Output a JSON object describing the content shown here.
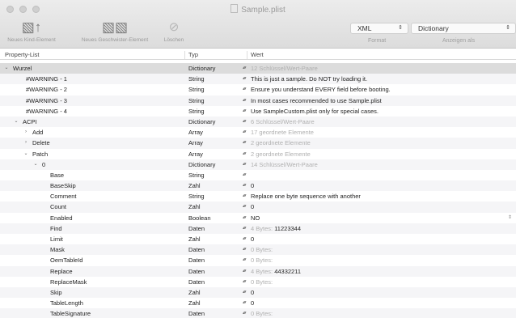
{
  "window": {
    "title": "Sample.plist"
  },
  "toolbar": {
    "add_child_label": "Neues Kind-Element",
    "add_sibling_label": "Neues Geschwister-Element",
    "remove_label": "Löschen"
  },
  "format_select": {
    "value": "XML",
    "label": "Format"
  },
  "type_select": {
    "value": "Dictionary",
    "label": "Anzeigen als"
  },
  "columns": {
    "key": "Property-List",
    "type": "Typ",
    "value": "Wert"
  },
  "rows": [
    {
      "key": "Wurzel",
      "type": "Dictionary",
      "value": "12 Schlüssel/Wert-Paare",
      "disc": "v",
      "gray": true,
      "selected": true
    },
    {
      "key": "#WARNING - 1",
      "type": "String",
      "value": "This is just a sample. Do NOT try loading it."
    },
    {
      "key": "#WARNING - 2",
      "type": "String",
      "value": "Ensure you understand EVERY field before booting."
    },
    {
      "key": "#WARNING - 3",
      "type": "String",
      "value": "In most cases recommended to use Sample.plist"
    },
    {
      "key": "#WARNING - 4",
      "type": "String",
      "value": "Use SampleCustom.plist only for special cases."
    },
    {
      "key": "ACPI",
      "type": "Dictionary",
      "value": "6 Schlüssel/Wert-Paare",
      "disc": "v",
      "gray": true
    },
    {
      "key": "Add",
      "type": "Array",
      "value": "17 geordnete Elemente",
      "disc": ">",
      "gray": true
    },
    {
      "key": "Delete",
      "type": "Array",
      "value": "2 geordnete Elemente",
      "disc": ">",
      "gray": true
    },
    {
      "key": "Patch",
      "type": "Array",
      "value": "2 geordnete Elemente",
      "disc": "v",
      "gray": true
    },
    {
      "key": "0",
      "type": "Dictionary",
      "value": "14 Schlüssel/Wert-Paare",
      "disc": "v",
      "gray": true
    },
    {
      "key": "Base",
      "type": "String",
      "value": ""
    },
    {
      "key": "BaseSkip",
      "type": "Zahl",
      "value": "0"
    },
    {
      "key": "Comment",
      "type": "String",
      "value": "Replace one byte sequence with another"
    },
    {
      "key": "Count",
      "type": "Zahl",
      "value": "0"
    },
    {
      "key": "Enabled",
      "type": "Boolean",
      "value": "NO"
    },
    {
      "key": "Find",
      "type": "Daten",
      "value": "4 Bytes:",
      "value2": "11223344",
      "gray": true
    },
    {
      "key": "Limit",
      "type": "Zahl",
      "value": "0"
    },
    {
      "key": "Mask",
      "type": "Daten",
      "value": "0 Bytes:",
      "gray": true
    },
    {
      "key": "OemTableId",
      "type": "Daten",
      "value": "0 Bytes:",
      "gray": true
    },
    {
      "key": "Replace",
      "type": "Daten",
      "value": "4 Bytes:",
      "value2": "44332211",
      "gray": true
    },
    {
      "key": "ReplaceMask",
      "type": "Daten",
      "value": "0 Bytes:",
      "gray": true
    },
    {
      "key": "Skip",
      "type": "Zahl",
      "value": "0"
    },
    {
      "key": "TableLength",
      "type": "Zahl",
      "value": "0"
    },
    {
      "key": "TableSignature",
      "type": "Daten",
      "value": "0 Bytes:",
      "gray": true
    }
  ],
  "icons": {
    "add_child": "add-child-icon",
    "add_sibling": "add-sibling-icon",
    "remove": "remove-icon"
  }
}
